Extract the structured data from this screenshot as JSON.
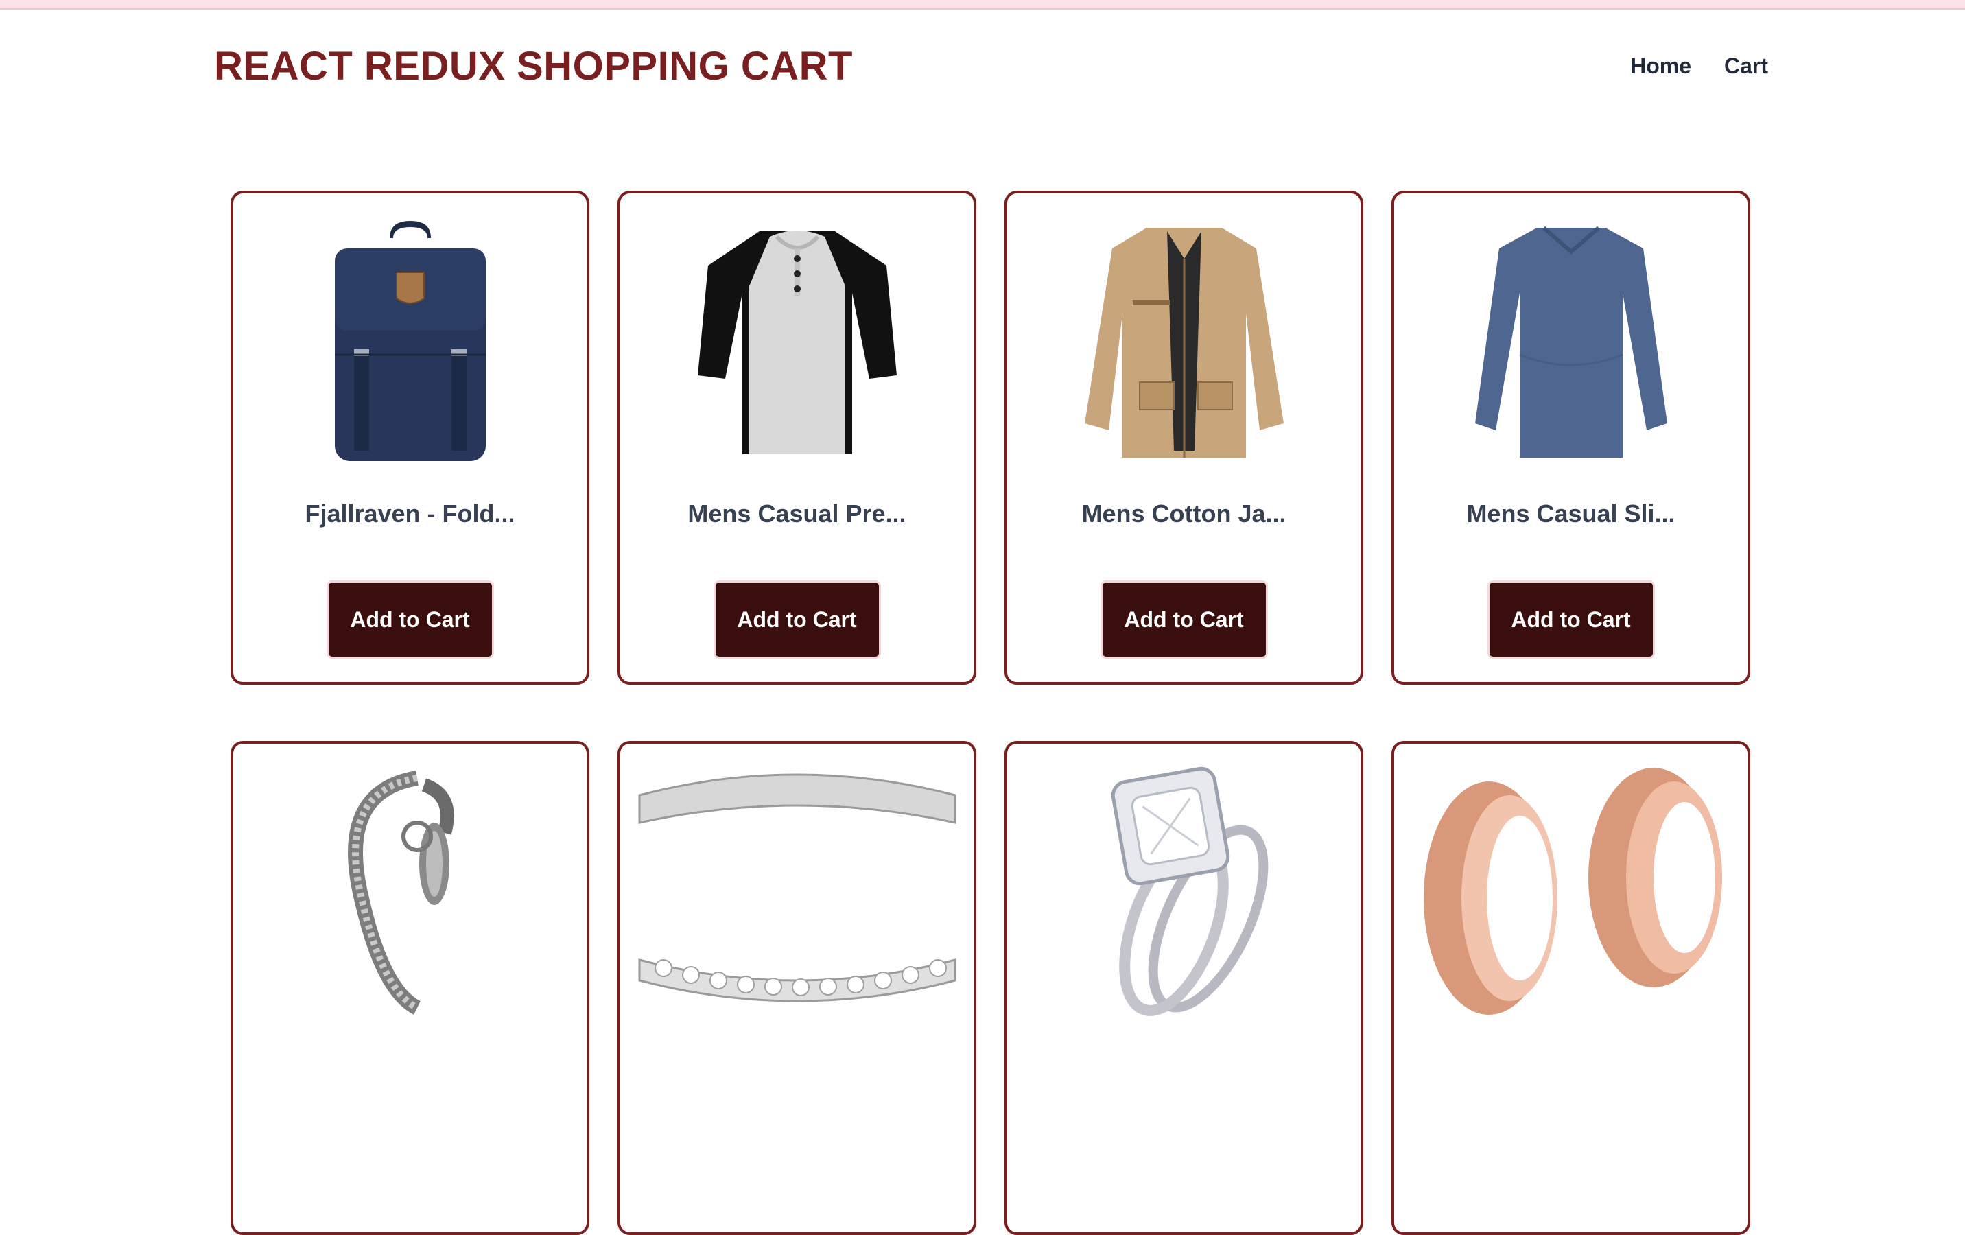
{
  "header": {
    "logo": "REACT REDUX SHOPPING CART",
    "nav": [
      {
        "label": "Home"
      },
      {
        "label": "Cart"
      }
    ]
  },
  "colors": {
    "brand": "#7a1f1f",
    "button_bg": "#3b0e0e",
    "top_strip": "#fde2e7"
  },
  "products": [
    {
      "title": "Fjallraven - Fold...",
      "button": "Add to Cart",
      "image": "navy-backpack"
    },
    {
      "title": "Mens Casual Pre...",
      "button": "Add to Cart",
      "image": "raglan-henley-tshirt"
    },
    {
      "title": "Mens Cotton Ja...",
      "button": "Add to Cart",
      "image": "khaki-cotton-jacket"
    },
    {
      "title": "Mens Casual Sli...",
      "button": "Add to Cart",
      "image": "blue-long-sleeve-shirt"
    },
    {
      "title": "",
      "button": "",
      "image": "dragon-chain-bracelet"
    },
    {
      "title": "",
      "button": "",
      "image": "silver-eternity-ring"
    },
    {
      "title": "",
      "button": "",
      "image": "diamond-halo-ring-set"
    },
    {
      "title": "",
      "button": "",
      "image": "rose-gold-ear-tunnels"
    }
  ]
}
